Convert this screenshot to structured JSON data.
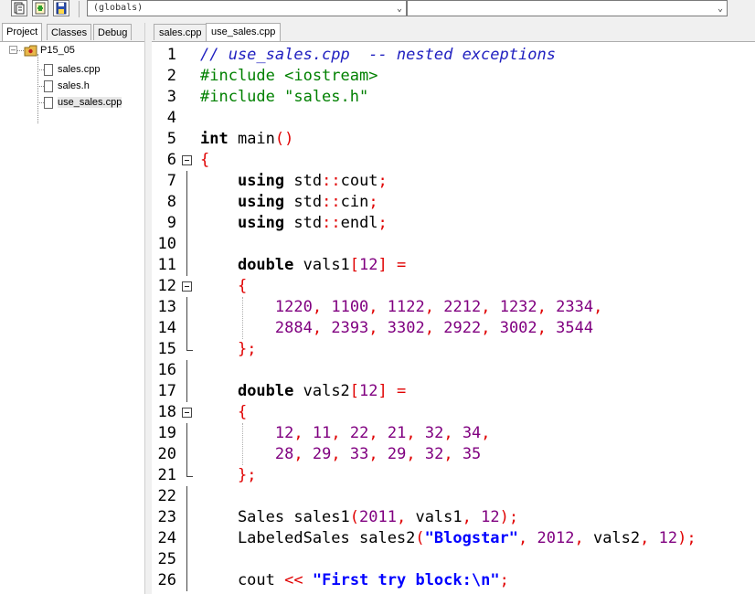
{
  "toolbar": {
    "scope_combo_value": "(globals)"
  },
  "left_panel": {
    "tabs": [
      {
        "label": "Project"
      },
      {
        "label": "Classes"
      },
      {
        "label": "Debug"
      }
    ],
    "tree": {
      "project": "P15_05",
      "files": [
        "sales.cpp",
        "sales.h",
        "use_sales.cpp"
      ]
    }
  },
  "editor_tabs": [
    {
      "label": "sales.cpp"
    },
    {
      "label": "use_sales.cpp"
    }
  ],
  "code_lines": [
    {
      "n": "1",
      "text": "// use_sales.cpp  -- nested exceptions"
    },
    {
      "n": "2",
      "text": "#include <iostream>"
    },
    {
      "n": "3",
      "text": "#include \"sales.h\""
    },
    {
      "n": "4",
      "text": ""
    },
    {
      "n": "5",
      "text": "int main()"
    },
    {
      "n": "6",
      "text": "{"
    },
    {
      "n": "7",
      "text": "    using std::cout;"
    },
    {
      "n": "8",
      "text": "    using std::cin;"
    },
    {
      "n": "9",
      "text": "    using std::endl;"
    },
    {
      "n": "10",
      "text": ""
    },
    {
      "n": "11",
      "text": "    double vals1[12] ="
    },
    {
      "n": "12",
      "text": "    {"
    },
    {
      "n": "13",
      "text": "        1220, 1100, 1122, 2212, 1232, 2334,"
    },
    {
      "n": "14",
      "text": "        2884, 2393, 3302, 2922, 3002, 3544"
    },
    {
      "n": "15",
      "text": "    };"
    },
    {
      "n": "16",
      "text": ""
    },
    {
      "n": "17",
      "text": "    double vals2[12] ="
    },
    {
      "n": "18",
      "text": "    {"
    },
    {
      "n": "19",
      "text": "        12, 11, 22, 21, 32, 34,"
    },
    {
      "n": "20",
      "text": "        28, 29, 33, 29, 32, 35"
    },
    {
      "n": "21",
      "text": "    };"
    },
    {
      "n": "22",
      "text": ""
    },
    {
      "n": "23",
      "text": "    Sales sales1(2011, vals1, 12);"
    },
    {
      "n": "24",
      "text": "    LabeledSales sales2(\"Blogstar\", 2012, vals2, 12);"
    },
    {
      "n": "25",
      "text": ""
    },
    {
      "n": "26",
      "text": "    cout << \"First try block:\\n\";"
    }
  ],
  "icons": {
    "toolbar_1": "new-file-icon",
    "toolbar_2": "add-file-icon",
    "toolbar_3": "save-icon",
    "tree_folder": "project-folder-icon",
    "tree_file": "document-icon"
  },
  "colors": {
    "comment": "#2020c0",
    "preprocessor": "#008000",
    "number": "#800080",
    "operator": "#e00000",
    "string": "#0000ff"
  }
}
